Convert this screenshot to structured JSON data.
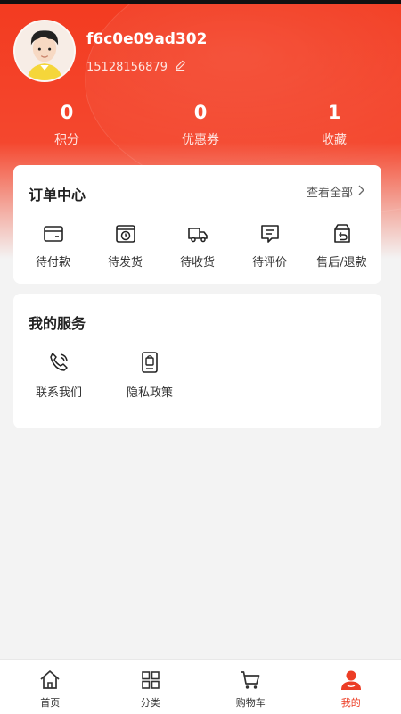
{
  "header": {
    "username": "f6c0e09ad302",
    "phone": "15128156879"
  },
  "stats": [
    {
      "value": "0",
      "label": "积分"
    },
    {
      "value": "0",
      "label": "优惠券"
    },
    {
      "value": "1",
      "label": "收藏"
    }
  ],
  "orders": {
    "title": "订单中心",
    "view_all": "查看全部",
    "items": [
      {
        "label": "待付款",
        "icon": "wallet-icon"
      },
      {
        "label": "待发货",
        "icon": "package-clock-icon"
      },
      {
        "label": "待收货",
        "icon": "truck-icon"
      },
      {
        "label": "待评价",
        "icon": "comment-icon"
      },
      {
        "label": "售后/退款",
        "icon": "return-box-icon"
      }
    ]
  },
  "services": {
    "title": "我的服务",
    "items": [
      {
        "label": "联系我们",
        "icon": "phone-icon"
      },
      {
        "label": "隐私政策",
        "icon": "document-icon"
      }
    ]
  },
  "tabbar": {
    "items": [
      {
        "label": "首页",
        "icon": "home-icon"
      },
      {
        "label": "分类",
        "icon": "grid-icon"
      },
      {
        "label": "购物车",
        "icon": "cart-icon"
      },
      {
        "label": "我的",
        "icon": "user-icon",
        "active": true
      }
    ],
    "active_color": "#ec3d25"
  },
  "colors": {
    "brand": "#f33b20",
    "background": "#f3f3f3"
  }
}
